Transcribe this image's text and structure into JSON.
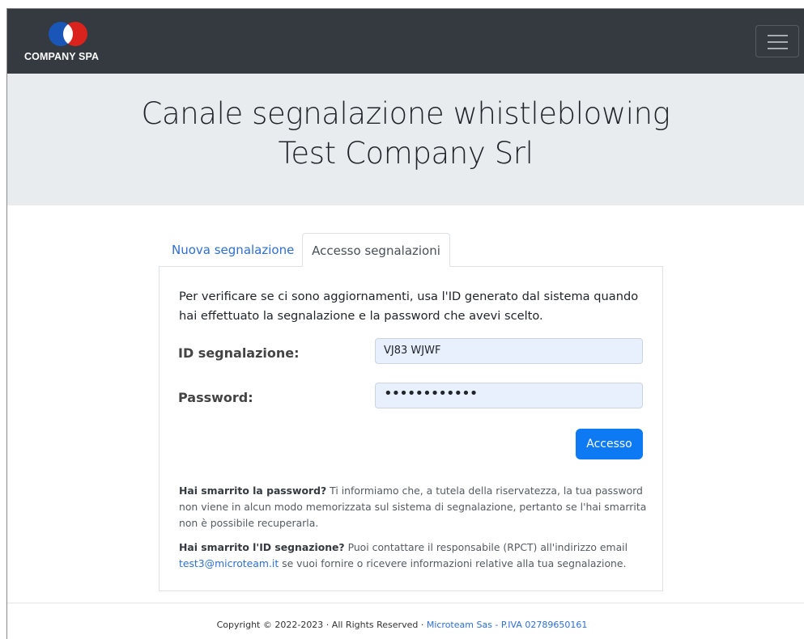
{
  "brand": {
    "name": "COMPANY SPA",
    "colors": {
      "blue": "#1a56b8",
      "red": "#d9231c"
    }
  },
  "navbar": {
    "toggler_icon": "hamburger-menu-icon",
    "background": "#343a40"
  },
  "hero": {
    "title_line1": "Canale segnalazione whistleblowing",
    "title_line2": "Test Company Srl"
  },
  "tabs": [
    {
      "label": "Nuova segnalazione",
      "active": false
    },
    {
      "label": "Accesso segnalazioni",
      "active": true
    }
  ],
  "form": {
    "intro": "Per verificare se ci sono aggiornamenti, usa l'ID generato dal sistema quando hai effettuato la segnalazione e la password che avevi scelto.",
    "id_label": "ID segnalazione:",
    "id_value": "VJ83 WJWF",
    "password_label": "Password:",
    "password_value": "••••••••••••",
    "submit_label": "Accesso",
    "accent": "#0d79f2"
  },
  "help": {
    "lost_password_title": "Hai smarrito la password?",
    "lost_password_text": "Ti informiamo che, a tutela della riservatezza, la tua password non viene in alcun modo memorizzata sul sistema di segnalazione, pertanto se l'hai smarrita non è possibile recuperarla.",
    "lost_id_title": "Hai smarrito l'ID segnazione?",
    "lost_id_text_before": "Puoi contattare il responsabile (RPCT) all'indirizzo email",
    "email": "test3@microteam.it",
    "lost_id_text_after": "se vuoi fornire o ricevere informazioni relative alla tua segnalazione."
  },
  "footer": {
    "copyright": "Copyright © 2022-2023 · All Rights Reserved ·",
    "company_link": "Microteam Sas - P.IVA 02789650161"
  }
}
